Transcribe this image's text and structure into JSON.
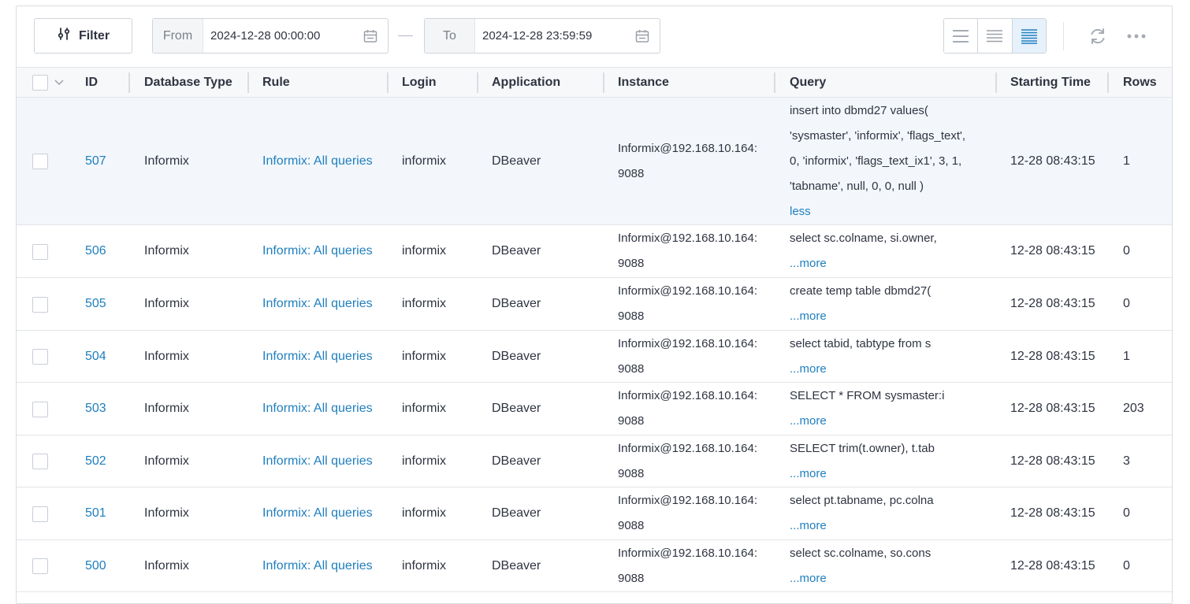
{
  "toolbar": {
    "filter_label": "Filter",
    "from_label": "From",
    "from_value": "2024-12-28 00:00:00",
    "to_label": "To",
    "to_value": "2024-12-28 23:59:59",
    "density_active": "compact",
    "accent_color": "#1f7fbf"
  },
  "table": {
    "columns": [
      "ID",
      "Database Type",
      "Rule",
      "Login",
      "Application",
      "Instance",
      "Query",
      "Starting Time",
      "Rows"
    ],
    "rows": [
      {
        "id": "507",
        "db_type": "Informix",
        "rule": "Informix: All queries",
        "login": "informix",
        "application": "DBeaver",
        "instance_1": "Informix@192.168.10.164:",
        "instance_2": "9088",
        "query_lines": [
          "insert into dbmd27 values(",
          "'sysmaster', 'informix', 'flags_text',",
          "0, 'informix', 'flags_text_ix1', 3, 1,",
          "'tabname', null,  0, 0, null )"
        ],
        "toggle": "less",
        "start_time": "12-28 08:43:15",
        "rows": "1"
      },
      {
        "id": "506",
        "db_type": "Informix",
        "rule": "Informix: All queries",
        "login": "informix",
        "application": "DBeaver",
        "instance_1": "Informix@192.168.10.164:",
        "instance_2": "9088",
        "query_lines": [
          "select sc.colname, si.owner,"
        ],
        "toggle": "...more",
        "start_time": "12-28 08:43:15",
        "rows": "0"
      },
      {
        "id": "505",
        "db_type": "Informix",
        "rule": "Informix: All queries",
        "login": "informix",
        "application": "DBeaver",
        "instance_1": "Informix@192.168.10.164:",
        "instance_2": "9088",
        "query_lines": [
          "create temp table dbmd27("
        ],
        "toggle": "...more",
        "start_time": "12-28 08:43:15",
        "rows": "0"
      },
      {
        "id": "504",
        "db_type": "Informix",
        "rule": "Informix: All queries",
        "login": "informix",
        "application": "DBeaver",
        "instance_1": "Informix@192.168.10.164:",
        "instance_2": "9088",
        "query_lines": [
          "select tabid, tabtype from s"
        ],
        "toggle": "...more",
        "start_time": "12-28 08:43:15",
        "rows": "1"
      },
      {
        "id": "503",
        "db_type": "Informix",
        "rule": "Informix: All queries",
        "login": "informix",
        "application": "DBeaver",
        "instance_1": "Informix@192.168.10.164:",
        "instance_2": "9088",
        "query_lines": [
          "SELECT * FROM sysmaster:i"
        ],
        "toggle": "...more",
        "start_time": "12-28 08:43:15",
        "rows": "203"
      },
      {
        "id": "502",
        "db_type": "Informix",
        "rule": "Informix: All queries",
        "login": "informix",
        "application": "DBeaver",
        "instance_1": "Informix@192.168.10.164:",
        "instance_2": "9088",
        "query_lines": [
          "SELECT trim(t.owner), t.tab"
        ],
        "toggle": "...more",
        "start_time": "12-28 08:43:15",
        "rows": "3"
      },
      {
        "id": "501",
        "db_type": "Informix",
        "rule": "Informix: All queries",
        "login": "informix",
        "application": "DBeaver",
        "instance_1": "Informix@192.168.10.164:",
        "instance_2": "9088",
        "query_lines": [
          "select pt.tabname, pc.colna"
        ],
        "toggle": "...more",
        "start_time": "12-28 08:43:15",
        "rows": "0"
      },
      {
        "id": "500",
        "db_type": "Informix",
        "rule": "Informix: All queries",
        "login": "informix",
        "application": "DBeaver",
        "instance_1": "Informix@192.168.10.164:",
        "instance_2": "9088",
        "query_lines": [
          "select   sc.colname,  so.cons"
        ],
        "toggle": "...more",
        "start_time": "12-28 08:43:15",
        "rows": "0"
      }
    ]
  }
}
